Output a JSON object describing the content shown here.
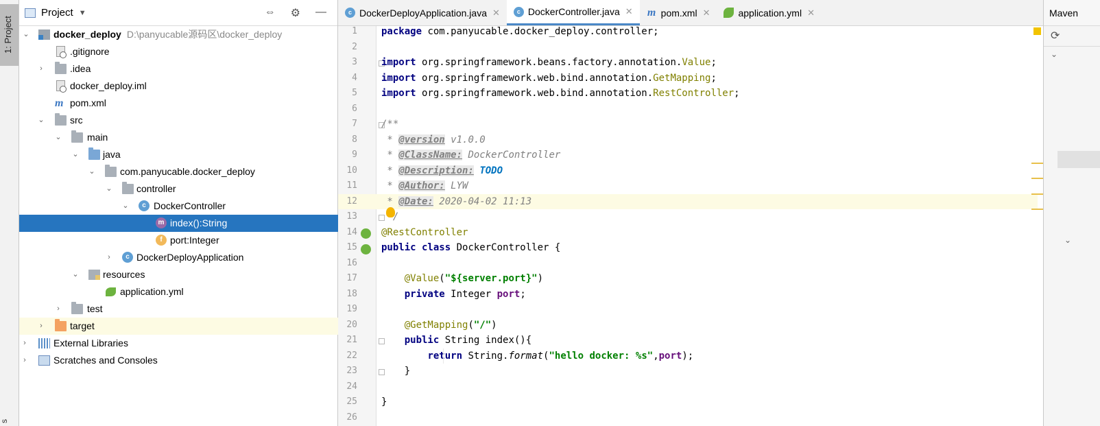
{
  "left_strip": {
    "tab_label": "1: Project",
    "bottom_label": "s"
  },
  "project": {
    "title": "Project",
    "tree": [
      {
        "label": "docker_deploy",
        "path": "D:\\panyucable源码区\\docker_deploy",
        "icon": "module-folder-icon",
        "bold": true
      },
      {
        "label": ".gitignore",
        "icon": "gitignore-file-icon"
      },
      {
        "label": ".idea",
        "icon": "folder-icon"
      },
      {
        "label": "docker_deploy.iml",
        "icon": "iml-file-icon"
      },
      {
        "label": "pom.xml",
        "icon": "maven-icon"
      },
      {
        "label": "src",
        "icon": "folder-icon"
      },
      {
        "label": "main",
        "icon": "folder-icon"
      },
      {
        "label": "java",
        "icon": "source-folder-icon"
      },
      {
        "label": "com.panyucable.docker_deploy",
        "icon": "package-icon"
      },
      {
        "label": "controller",
        "icon": "package-icon"
      },
      {
        "label": "DockerController",
        "icon": "class-icon"
      },
      {
        "label": "index():String",
        "icon": "method-icon",
        "selected": true
      },
      {
        "label": "port:Integer",
        "icon": "field-icon"
      },
      {
        "label": "DockerDeployApplication",
        "icon": "spring-boot-class-icon"
      },
      {
        "label": "resources",
        "icon": "resources-folder-icon"
      },
      {
        "label": "application.yml",
        "icon": "spring-config-icon"
      },
      {
        "label": "test",
        "icon": "folder-icon"
      },
      {
        "label": "target",
        "icon": "excluded-folder-icon"
      },
      {
        "label": "External Libraries",
        "icon": "libraries-icon"
      },
      {
        "label": "Scratches and Consoles",
        "icon": "scratches-icon"
      }
    ]
  },
  "editor": {
    "tabs": [
      {
        "label": "DockerDeployApplication.java",
        "icon": "spring-boot-class-icon"
      },
      {
        "label": "DockerController.java",
        "icon": "class-icon",
        "active": true
      },
      {
        "label": "pom.xml",
        "icon": "maven-icon"
      },
      {
        "label": "application.yml",
        "icon": "spring-config-icon"
      }
    ],
    "line_numbers": [
      "1",
      "2",
      "3",
      "4",
      "5",
      "6",
      "7",
      "8",
      "9",
      "10",
      "11",
      "12",
      "13",
      "14",
      "15",
      "16",
      "17",
      "18",
      "19",
      "20",
      "21",
      "22",
      "23",
      "24",
      "25",
      "26"
    ],
    "code": {
      "l1_kw": "package",
      "l1_rest": " com.panyucable.docker_deploy.controller;",
      "import_kw": "import",
      "l3_pkg": " org.springframework.beans.factory.annotation.",
      "l3_cls": "Value",
      "semi": ";",
      "l4_pkg": " org.springframework.web.bind.annotation.",
      "l4_cls": "GetMapping",
      "l5_pkg": " org.springframework.web.bind.annotation.",
      "l5_cls": "RestController",
      "l7": "/**",
      "star": " * ",
      "l8_tag": "@version",
      "l8_val": " v1.0.0",
      "l9_tag": "@ClassName:",
      "l9_val": " DockerController",
      "l10_tag": "@Description:",
      "l10_val": "TODO",
      "l11_tag": "@Author:",
      "l11_val": " LYW",
      "l12_tag": "@Date:",
      "l12_val": " 2020-04-02 11:13",
      "l13": " */",
      "l14": "@RestController",
      "l15_kw": "public class",
      "l15_rest": " DockerController {",
      "l17_ann": "@Value",
      "l17_open": "(",
      "l17_str": "\"${server.port}\"",
      "l17_close": ")",
      "l18_kw": "private",
      "l18_type": " Integer ",
      "l18_fld": "port",
      "l18_end": ";",
      "l20_ann": "@GetMapping",
      "l20_str": "\"/\"",
      "l21_kw": "public",
      "l21_rest": " String index(){",
      "l22_kw": "return",
      "l22_a": " String.",
      "l22_fn": "format",
      "l22_open": "(",
      "l22_str": "\"hello docker: %s\"",
      "l22_comma": ",",
      "l22_fld": "port",
      "l22_end": ");",
      "l23": "}",
      "l25": "}"
    }
  },
  "maven": {
    "title": "Maven"
  },
  "colors": {
    "selection": "#2675bf",
    "current_line": "#fdfbe3",
    "keyword": "#000080",
    "annotation": "#808000",
    "string": "#008000",
    "field": "#660e7a"
  }
}
